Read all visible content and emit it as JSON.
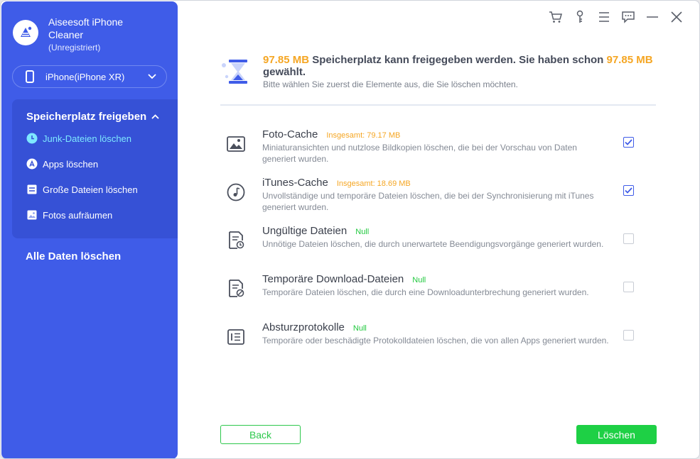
{
  "app": {
    "name": "Aiseesoft iPhone Cleaner",
    "registration": "(Unregistriert)"
  },
  "device": {
    "label": "iPhone(iPhone XR)"
  },
  "sidebar": {
    "group_title": "Speicherplatz freigeben",
    "items": [
      {
        "label": "Junk-Dateien löschen",
        "icon": "clock-icon",
        "active": true
      },
      {
        "label": "Apps löschen",
        "icon": "app-store-icon",
        "active": false
      },
      {
        "label": "Große Dateien löschen",
        "icon": "large-file-icon",
        "active": false
      },
      {
        "label": "Fotos aufräumen",
        "icon": "photo-icon",
        "active": false
      }
    ],
    "all_data": "Alle Daten löschen"
  },
  "topbar": [
    "cart-icon",
    "key-icon",
    "menu-icon",
    "feedback-icon",
    "minimize-icon",
    "close-icon"
  ],
  "header": {
    "size1": "97.85 MB",
    "text1": " Speicherplatz kann freigegeben werden. Sie haben schon ",
    "size2": "97.85 MB",
    "text2": " gewählt.",
    "subtitle": "Bitte wählen Sie zuerst die Elemente aus, die Sie löschen möchten."
  },
  "items": [
    {
      "title": "Foto-Cache",
      "status": "Insgesamt: 79.17 MB",
      "status_type": "total",
      "desc": "Miniaturansichten und nutzlose Bildkopien löschen, die bei der Vorschau von Daten generiert wurden.",
      "checked": true,
      "icon": "image-icon"
    },
    {
      "title": "iTunes-Cache",
      "status": "Insgesamt: 18.69 MB",
      "status_type": "total",
      "desc": "Unvollständige und temporäre Dateien löschen, die bei der Synchronisierung mit iTunes generiert wurden.",
      "checked": true,
      "icon": "music-note-icon"
    },
    {
      "title": "Ungültige Dateien",
      "status": "Null",
      "status_type": "null",
      "desc": "Unnötige Dateien löschen, die durch unerwartete Beendigungsvorgänge generiert wurden.",
      "checked": false,
      "icon": "invalid-file-icon"
    },
    {
      "title": "Temporäre Download-Dateien",
      "status": "Null",
      "status_type": "null",
      "desc": "Temporäre Dateien löschen, die durch eine Downloadunterbrechung generiert wurden.",
      "checked": false,
      "icon": "temp-download-icon"
    },
    {
      "title": "Absturzprotokolle",
      "status": "Null",
      "status_type": "null",
      "desc": "Temporäre oder beschädigte Protokolldateien löschen, die von allen Apps generiert wurden.",
      "checked": false,
      "icon": "crash-log-icon"
    }
  ],
  "buttons": {
    "back": "Back",
    "delete": "Löschen"
  },
  "colors": {
    "sidebar": "#3f5ce8",
    "accent_orange": "#f5a623",
    "green": "#1ed045"
  }
}
